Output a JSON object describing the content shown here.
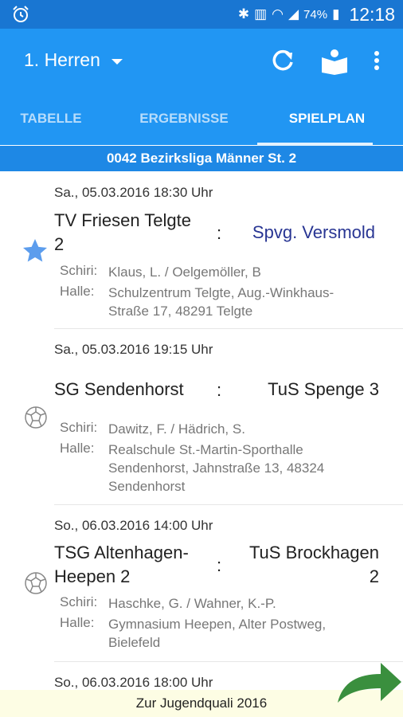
{
  "status_bar": {
    "battery": "74%",
    "time": "12:18"
  },
  "app_bar": {
    "title": "1. Herren"
  },
  "tabs": [
    {
      "label": "TABELLE"
    },
    {
      "label": "ERGEBNISSE"
    },
    {
      "label": "SPIELPLAN",
      "active": true
    }
  ],
  "league": {
    "label": "0042 Bezirksliga Männer St. 2"
  },
  "matches": [
    {
      "datetime": "Sa., 05.03.2016  18:30 Uhr",
      "home_line1": "TV Friesen Telgte",
      "home_line2": "2",
      "separator": ":",
      "away": "Spvg. Versmold",
      "schiri_label": "Schiri:",
      "schiri": "Klaus, L. / Oelgemöller, B",
      "halle_label": "Halle:",
      "halle_line1": "Schulzentrum Telgte, Aug.-Winkhaus-",
      "halle_line2": "Straße 17, 48291 Telgte",
      "icon": "star-icon"
    },
    {
      "datetime": "Sa., 05.03.2016  19:15 Uhr",
      "home_line1": "SG Sendenhorst",
      "separator": ":",
      "away": "TuS Spenge 3",
      "schiri_label": "Schiri:",
      "schiri": "Dawitz, F. / Hädrich, S.",
      "halle_label": "Halle:",
      "halle_line1": "Realschule St.-Martin-Sporthalle",
      "halle_line2": "Sendenhorst, Jahnstraße 13, 48324",
      "halle_line3": "Sendenhorst",
      "icon": "handball-icon"
    },
    {
      "datetime": "So., 06.03.2016  14:00 Uhr",
      "home_line1": "TSG Altenhagen-",
      "home_line2": "Heepen 2",
      "separator": ":",
      "away_line1": "TuS Brockhagen",
      "away_line2": "2",
      "schiri_label": "Schiri:",
      "schiri": "Haschke, G. / Wahner, K.-P.",
      "halle_label": "Halle:",
      "halle_line1": "Gymnasium Heepen, Alter Postweg,",
      "halle_line2": "Bielefeld",
      "icon": "handball-icon"
    },
    {
      "datetime": "So., 06.03.2016  18:00 Uhr"
    }
  ],
  "footer": {
    "label": "Zur Jugendquali 2016"
  },
  "colors": {
    "primary": "#2196f3",
    "status_bar": "#1976d2",
    "league_bar": "#1e88e5",
    "away_highlight": "#283593",
    "footer_bg": "#fdfde4",
    "arrow": "#3a8f3e"
  }
}
